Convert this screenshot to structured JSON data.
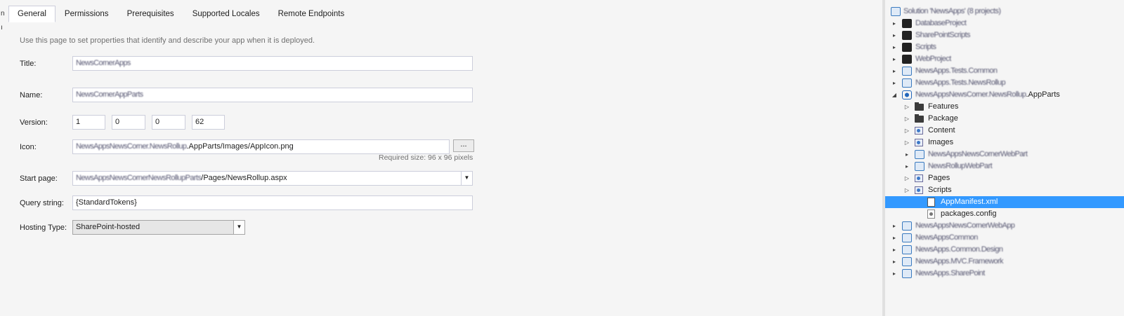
{
  "tabs": [
    "General",
    "Permissions",
    "Prerequisites",
    "Supported Locales",
    "Remote Endpoints"
  ],
  "description": "Use this page to set properties that identify and describe your app when it is deployed.",
  "form": {
    "title_label": "Title:",
    "title_value": "NewsCornerApps",
    "name_label": "Name:",
    "name_value": "NewsCornerAppParts",
    "version_label": "Version:",
    "version": [
      "1",
      "0",
      "0",
      "62"
    ],
    "icon_label": "Icon:",
    "icon_value_prefix": "NewsAppsNewsCorner.NewsRollup",
    "icon_value": ".AppParts/Images/AppIcon.png",
    "browse_label": "...",
    "required_size": "Required size: 96 x 96 pixels",
    "start_page_label": "Start page:",
    "start_page_prefix": "NewsAppsNewsCornerNewsRollupParts",
    "start_page_value": "/Pages/NewsRollup.aspx",
    "query_string_label": "Query string:",
    "query_string_value": "{StandardTokens}",
    "hosting_type_label": "Hosting Type:",
    "hosting_type_value": "SharePoint-hosted"
  },
  "explorer": {
    "solution": "Solution 'NewsApps' (8 projects)",
    "rows": [
      {
        "text": "DatabaseProject",
        "level": 0,
        "exp": "▸"
      },
      {
        "text": "SharePointScripts",
        "level": 0,
        "exp": "▸"
      },
      {
        "text": "Scripts",
        "level": 0,
        "exp": "▸"
      },
      {
        "text": "WebProject",
        "level": 0,
        "exp": "▸"
      },
      {
        "text": "NewsApps.Tests.Common",
        "level": 0,
        "exp": "▸"
      },
      {
        "text": "NewsApps.Tests.NewsRollup",
        "level": 0,
        "exp": "▸"
      },
      {
        "text": "NewsAppsNewsCorner.NewsRollup",
        "suffix": ".AppParts",
        "level": 0,
        "exp": "◢"
      },
      {
        "text": "Features",
        "level": 1,
        "exp": "▷"
      },
      {
        "text": "Package",
        "level": 1,
        "exp": "▷"
      },
      {
        "text": "Content",
        "level": 1,
        "exp": "▷"
      },
      {
        "text": "Images",
        "level": 1,
        "exp": "▷"
      },
      {
        "text": "NewsAppsNewsCornerWebPart",
        "level": 1,
        "exp": "▸"
      },
      {
        "text": "NewsRollupWebPart",
        "level": 1,
        "exp": "▸"
      },
      {
        "text": "Pages",
        "level": 1,
        "exp": "▷"
      },
      {
        "text": "Scripts",
        "level": 1,
        "exp": "▷"
      },
      {
        "text": "AppManifest.xml",
        "level": 2,
        "exp": "",
        "selected": true
      },
      {
        "text": "packages.config",
        "level": 2,
        "exp": ""
      },
      {
        "text": "NewsAppsNewsCornerWebApp",
        "level": 0,
        "exp": "▸"
      },
      {
        "text": "NewsAppsCommon",
        "level": 0,
        "exp": "▸"
      },
      {
        "text": "NewsApps.Common.Design",
        "level": 0,
        "exp": "▸"
      },
      {
        "text": "NewsApps.MVC.Framework",
        "level": 0,
        "exp": "▸"
      },
      {
        "text": "NewsApps.SharePoint",
        "level": 0,
        "exp": "▸"
      }
    ]
  },
  "colors": {
    "selection": "#3399ff",
    "background": "#f5f5f5"
  }
}
